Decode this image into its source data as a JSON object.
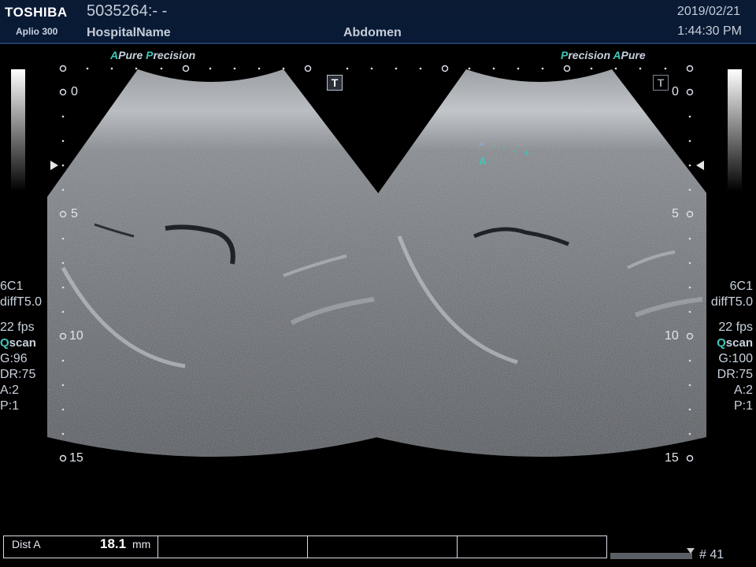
{
  "header": {
    "brand": "TOSHIBA",
    "model": "Aplio 300",
    "patient_id": "5035264:- -",
    "hospital": "HospitalName",
    "exam": "Abdomen",
    "date": "2019/02/21",
    "time": "1:44:30 PM"
  },
  "modes": {
    "left": [
      {
        "letter": "A",
        "text": "Pure"
      },
      {
        "letter": "P",
        "text": "recision"
      }
    ],
    "right": [
      {
        "letter": "P",
        "text": "recision"
      },
      {
        "letter": "A",
        "text": "Pure"
      }
    ]
  },
  "t_box": "T",
  "depth_scale": {
    "left": [
      "0",
      "5",
      "10",
      "15"
    ],
    "right": [
      "0",
      "5",
      "10",
      "15"
    ]
  },
  "params_left": {
    "probe": "6C1",
    "preset": "diffT5.0",
    "fps": "22 fps",
    "qscan_q": "Q",
    "qscan_rest": "scan",
    "gain": "G:96",
    "dr": "DR:75",
    "a": "A:2",
    "p": "P:1"
  },
  "params_right": {
    "probe": "6C1",
    "preset": "diffT5.0",
    "fps": "22 fps",
    "qscan_q": "Q",
    "qscan_rest": "scan",
    "gain": "G:100",
    "dr": "DR:75",
    "a": "A:2",
    "p": "P:1"
  },
  "caliper_label": "A",
  "measurement": {
    "label": "Dist A",
    "value": "18.1",
    "unit": "mm"
  },
  "frame": "# 41",
  "colors": {
    "accent": "#3fc6b8",
    "header_bg": "#0a1a33"
  }
}
